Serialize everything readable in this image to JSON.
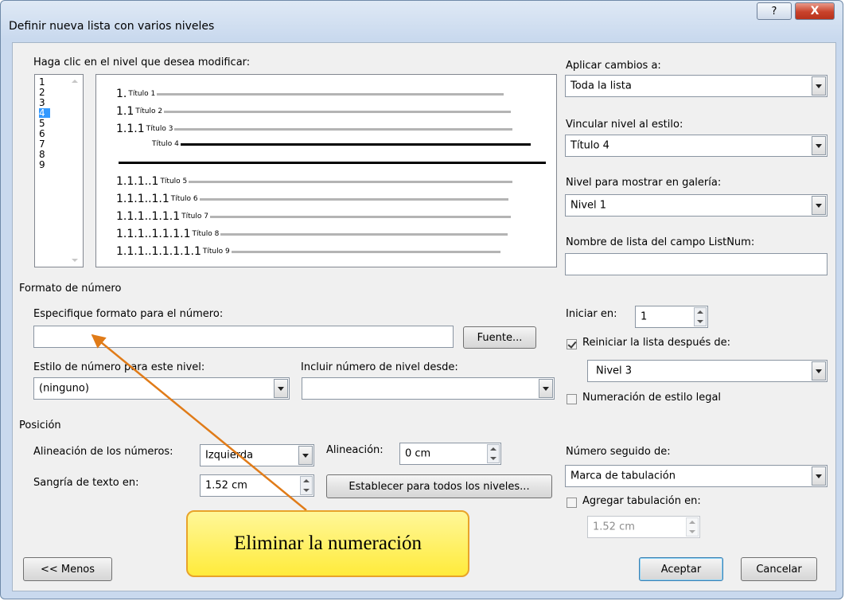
{
  "dialog": {
    "title": "Definir nueva lista con varios niveles",
    "help_glyph": "?",
    "close_glyph": "X"
  },
  "levels": {
    "label": "Haga clic en el nivel que desea modificar:",
    "items": [
      "1",
      "2",
      "3",
      "4",
      "5",
      "6",
      "7",
      "8",
      "9"
    ],
    "selected": "4"
  },
  "preview": {
    "rows": [
      {
        "num": "1.",
        "text": "Título 1"
      },
      {
        "num": "1.1",
        "text": "Título 2"
      },
      {
        "num": "1.1.1",
        "text": "Título 3"
      },
      {
        "num": "",
        "text": "Título 4"
      },
      {
        "num": "1.1.1..1",
        "text": "Título 5"
      },
      {
        "num": "1.1.1..1.1",
        "text": "Título 6"
      },
      {
        "num": "1.1.1..1.1.1",
        "text": "Título 7"
      },
      {
        "num": "1.1.1..1.1.1.1",
        "text": "Título 8"
      },
      {
        "num": "1.1.1..1.1.1.1.1",
        "text": "Título 9"
      }
    ]
  },
  "right_panel": {
    "apply_label": "Aplicar cambios a:",
    "apply_value": "Toda la lista",
    "link_label": "Vincular nivel al estilo:",
    "link_value": "Título 4",
    "gallery_label": "Nivel para mostrar en galería:",
    "gallery_value": "Nivel 1",
    "listnum_label": "Nombre de lista del campo ListNum:",
    "listnum_value": ""
  },
  "number_format": {
    "section_label": "Formato de número",
    "format_label": "Especifique formato para el número:",
    "format_value": "",
    "font_button": "Fuente...",
    "style_label": "Estilo de número para este nivel:",
    "style_value": "(ninguno)",
    "include_label": "Incluir número de nivel desde:",
    "include_value": "",
    "start_label": "Iniciar en:",
    "start_value": "1",
    "restart_label": "Reiniciar la lista después de:",
    "restart_checked": true,
    "restart_value": "Nivel 3",
    "legal_label": "Numeración de estilo legal",
    "legal_checked": false
  },
  "position": {
    "section_label": "Posición",
    "align_label": "Alineación de los números:",
    "align_value": "Izquierda",
    "at_label": "Alineación:",
    "at_value": "0 cm",
    "indent_label": "Sangría de texto en:",
    "indent_value": "1.52 cm",
    "set_all_button": "Establecer para todos los niveles...",
    "follow_label": "Número seguido de:",
    "follow_value": "Marca de tabulación",
    "tab_label": "Agregar tabulación en:",
    "tab_checked": false,
    "tab_value": "1.52 cm"
  },
  "buttons": {
    "less": "<< Menos",
    "ok": "Aceptar",
    "cancel": "Cancelar"
  },
  "annotation": {
    "callout_text": "Eliminar la numeración",
    "arrow_color": "#e07b18"
  }
}
